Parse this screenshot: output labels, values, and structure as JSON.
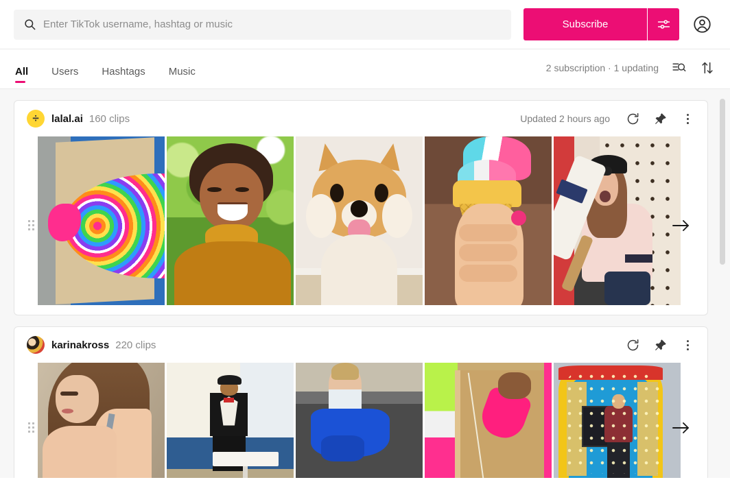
{
  "topbar": {
    "search_placeholder": "Enter TikTok username, hashtag or music",
    "search_value": "",
    "search_icon": "search-icon",
    "subscribe_label": "Subscribe",
    "settings_icon": "sliders-icon",
    "account_icon": "account-circle-icon",
    "accent_color": "#ec0e74"
  },
  "tabs": {
    "items": [
      {
        "label": "All",
        "active": true
      },
      {
        "label": "Users",
        "active": false
      },
      {
        "label": "Hashtags",
        "active": false
      },
      {
        "label": "Music",
        "active": false
      }
    ],
    "status_text": "2 subscription · 1 updating",
    "filter_icon": "filter-search-icon",
    "sort_icon": "sort-arrows-icon"
  },
  "cards": [
    {
      "channel": "lalal.ai",
      "clips": "160 clips",
      "updated": "Updated 2 hours ago",
      "avatar_kind": "division-sign",
      "avatar_color": "#ffd633",
      "refresh_icon": "refresh-icon",
      "pin_icon": "pin-icon",
      "more_icon": "more-vertical-icon",
      "next_icon": "arrow-right-icon",
      "drag_icon": "drag-handle-icon",
      "thumbs": [
        {
          "alt": "rainbow-spiral-paint-art",
          "art": "art-rainbow"
        },
        {
          "alt": "smiling-person-mustard-turtleneck",
          "art": "art-smile"
        },
        {
          "alt": "shiba-inu-dog",
          "art": "art-dog"
        },
        {
          "alt": "hand-holding-rainbow-ice-cream-cone",
          "art": "art-cone"
        },
        {
          "alt": "person-with-cap-holding-bat",
          "art": "art-bat"
        }
      ]
    },
    {
      "channel": "karinakross",
      "clips": "220 clips",
      "updated": "",
      "avatar_kind": "photo",
      "avatar_color": "#e8b23c",
      "refresh_icon": "refresh-icon",
      "pin_icon": "pin-icon",
      "more_icon": "more-vertical-icon",
      "next_icon": "arrow-right-icon",
      "drag_icon": "drag-handle-icon",
      "thumbs": [
        {
          "alt": "woman-with-long-brown-hair",
          "art": "art-woman"
        },
        {
          "alt": "person-in-tuxedo-print-shirt-by-table",
          "art": "art-tux"
        },
        {
          "alt": "person-lifting-blue-tarp-in-truck-bed",
          "art": "art-tarp"
        },
        {
          "alt": "pouring-pink-paint-from-bucket",
          "art": "art-bucket"
        },
        {
          "alt": "man-on-carnival-marquee-stage",
          "art": "art-stage"
        }
      ]
    }
  ],
  "scrollbar": {
    "name": "vertical-scrollbar"
  }
}
